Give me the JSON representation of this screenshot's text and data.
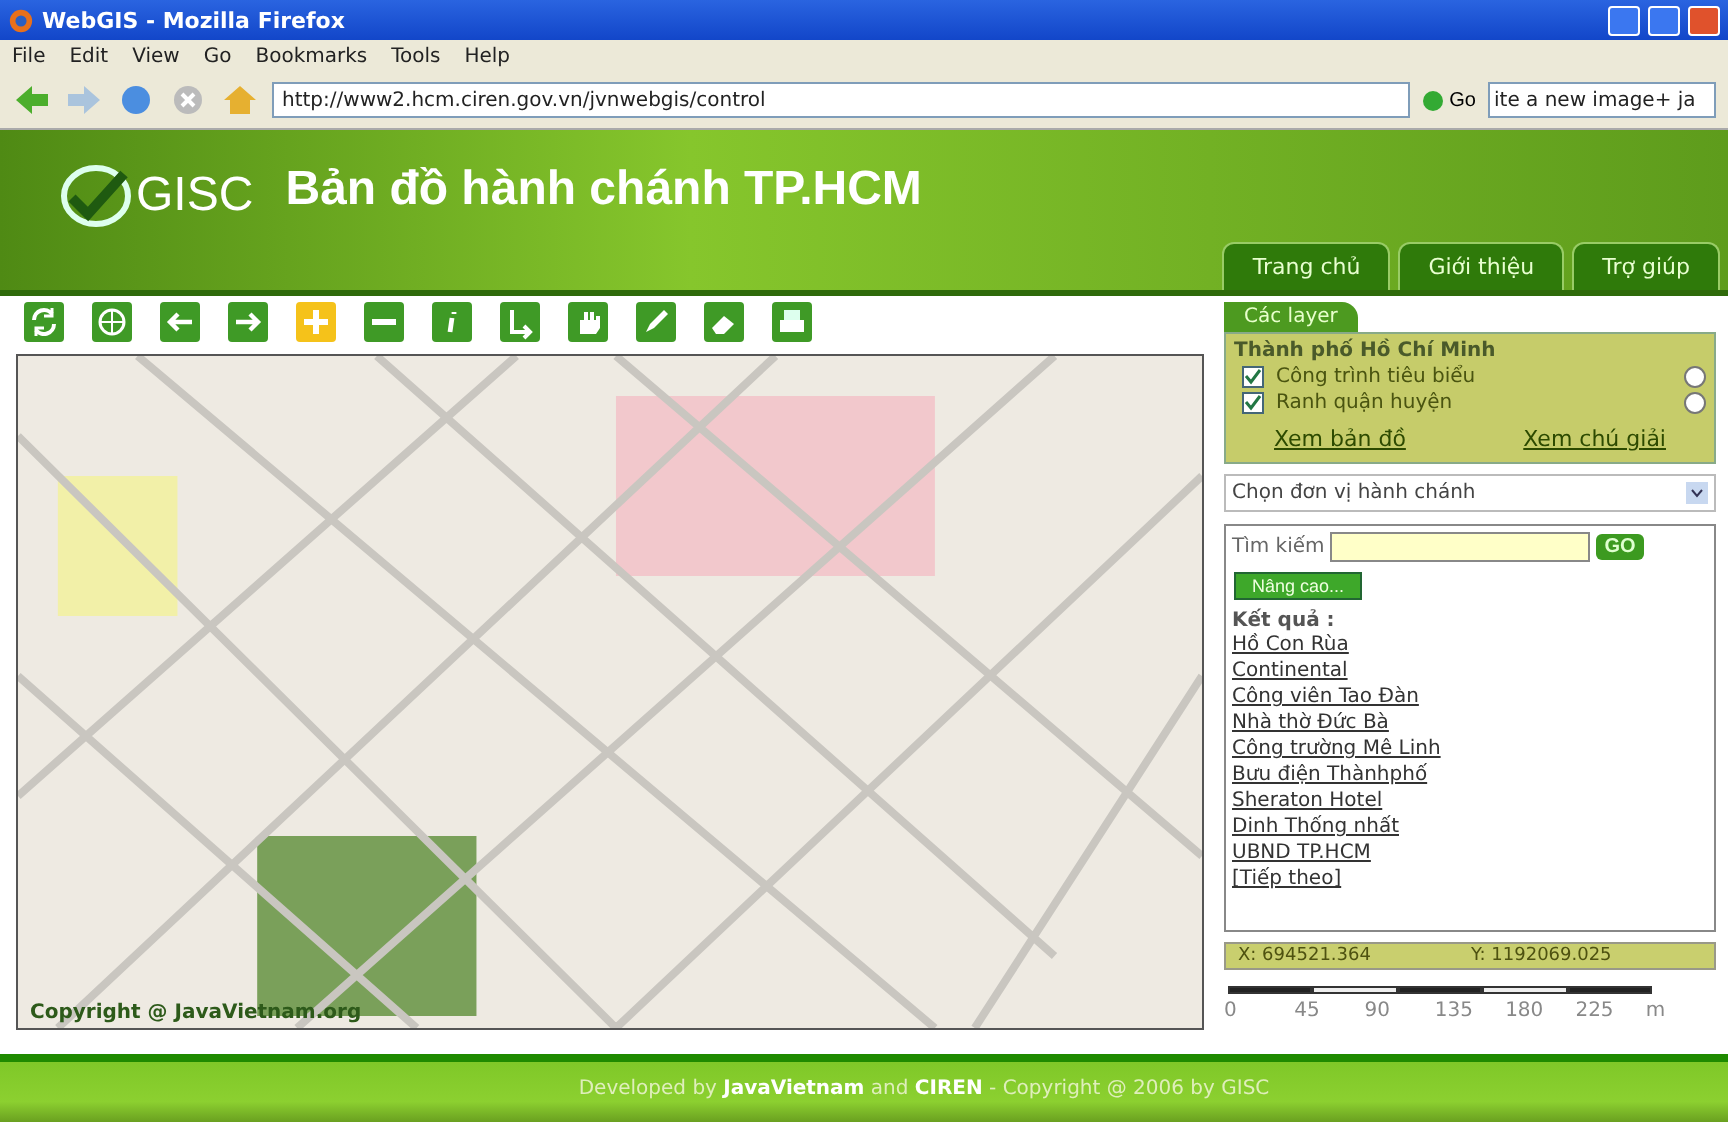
{
  "window": {
    "title": "WebGIS - Mozilla Firefox"
  },
  "menu": [
    "File",
    "Edit",
    "View",
    "Go",
    "Bookmarks",
    "Tools",
    "Help"
  ],
  "navigation": {
    "url": "http://www2.hcm.ciren.gov.vn/jvnwebgis/control",
    "go": "Go",
    "search_value": "ite a new image+ ja"
  },
  "header": {
    "logo": "GISC",
    "title": "Bản đồ hành chánh TP.HCM",
    "tabs": [
      "Trang chủ",
      "Giới thiệu",
      "Trợ giúp"
    ]
  },
  "tools": [
    {
      "kind": "refresh",
      "selected": false
    },
    {
      "kind": "globe",
      "selected": false
    },
    {
      "kind": "left",
      "selected": false
    },
    {
      "kind": "right",
      "selected": false
    },
    {
      "kind": "zoom-in",
      "selected": true
    },
    {
      "kind": "zoom-out",
      "selected": false
    },
    {
      "kind": "info",
      "selected": false
    },
    {
      "kind": "route",
      "selected": false
    },
    {
      "kind": "hand",
      "selected": false
    },
    {
      "kind": "pencil",
      "selected": false
    },
    {
      "kind": "eraser",
      "selected": false
    },
    {
      "kind": "print",
      "selected": false
    }
  ],
  "map": {
    "copyright": "Copyright @ JavaVietnam.org"
  },
  "layers": {
    "tab": "Các layer",
    "group": "Thành phố Hồ Chí Minh",
    "items": [
      {
        "label": "Công trình tiêu biểu",
        "checked": true,
        "selected": false
      },
      {
        "label": "Ranh quận huyện",
        "checked": true,
        "selected": false
      }
    ],
    "links": [
      "Xem bản đồ",
      "Xem chú giải"
    ]
  },
  "district_select": {
    "value": "Chọn đơn vị hành chánh"
  },
  "search": {
    "label": "Tìm kiếm",
    "go": "GO",
    "advanced": "Nâng cao...",
    "results_heading": "Kết quả :",
    "results": [
      "Hồ Con Rùa",
      "Continental",
      "Công viên Tao Đàn",
      "Nhà thờ Đức Bà",
      "Công trường Mê Linh",
      "Bưu điện Thànhphố",
      "Sheraton Hotel",
      "Dinh Thống nhất",
      "UBND TP.HCM"
    ],
    "next": "[Tiếp theo]"
  },
  "coordinates": {
    "x": "X: 694521.364",
    "y": "Y: 1192069.025"
  },
  "scale": {
    "labels": [
      "0",
      "45",
      "90",
      "135",
      "180",
      "225"
    ],
    "unit": "m"
  },
  "footer": {
    "text": "Developed by **JavaVietnam** and **CIREN** - Copyright @ 2006 by GISC"
  }
}
